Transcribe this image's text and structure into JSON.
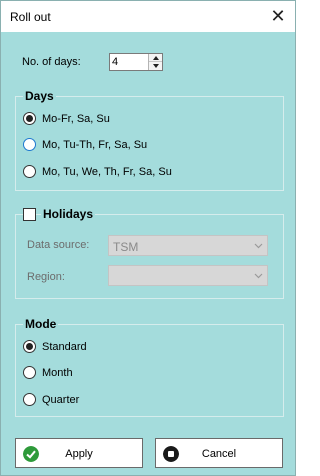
{
  "window": {
    "title": "Roll out",
    "close_glyph": "✕"
  },
  "days_count": {
    "label": "No. of days:",
    "value": "4"
  },
  "days_group": {
    "title": "Days",
    "options": [
      {
        "label": "Mo-Fr, Sa, Su",
        "selected": true
      },
      {
        "label": "Mo, Tu-Th, Fr, Sa, Su",
        "selected": false
      },
      {
        "label": "Mo, Tu, We, Th, Fr, Sa, Su",
        "selected": false
      }
    ]
  },
  "holidays_group": {
    "title": "Holidays",
    "checked": false,
    "data_source_label": "Data source:",
    "data_source_value": "TSM",
    "region_label": "Region:",
    "region_value": ""
  },
  "mode_group": {
    "title": "Mode",
    "options": [
      {
        "label": "Standard",
        "selected": true
      },
      {
        "label": "Month",
        "selected": false
      },
      {
        "label": "Quarter",
        "selected": false
      }
    ]
  },
  "buttons": {
    "apply_label": "Apply",
    "apply_icon": "check-icon",
    "cancel_label": "Cancel",
    "cancel_icon": "stop-icon"
  },
  "colors": {
    "background": "#a4dcdc",
    "apply_icon": "#2e9a3a",
    "cancel_icon": "#1a1a1a"
  }
}
